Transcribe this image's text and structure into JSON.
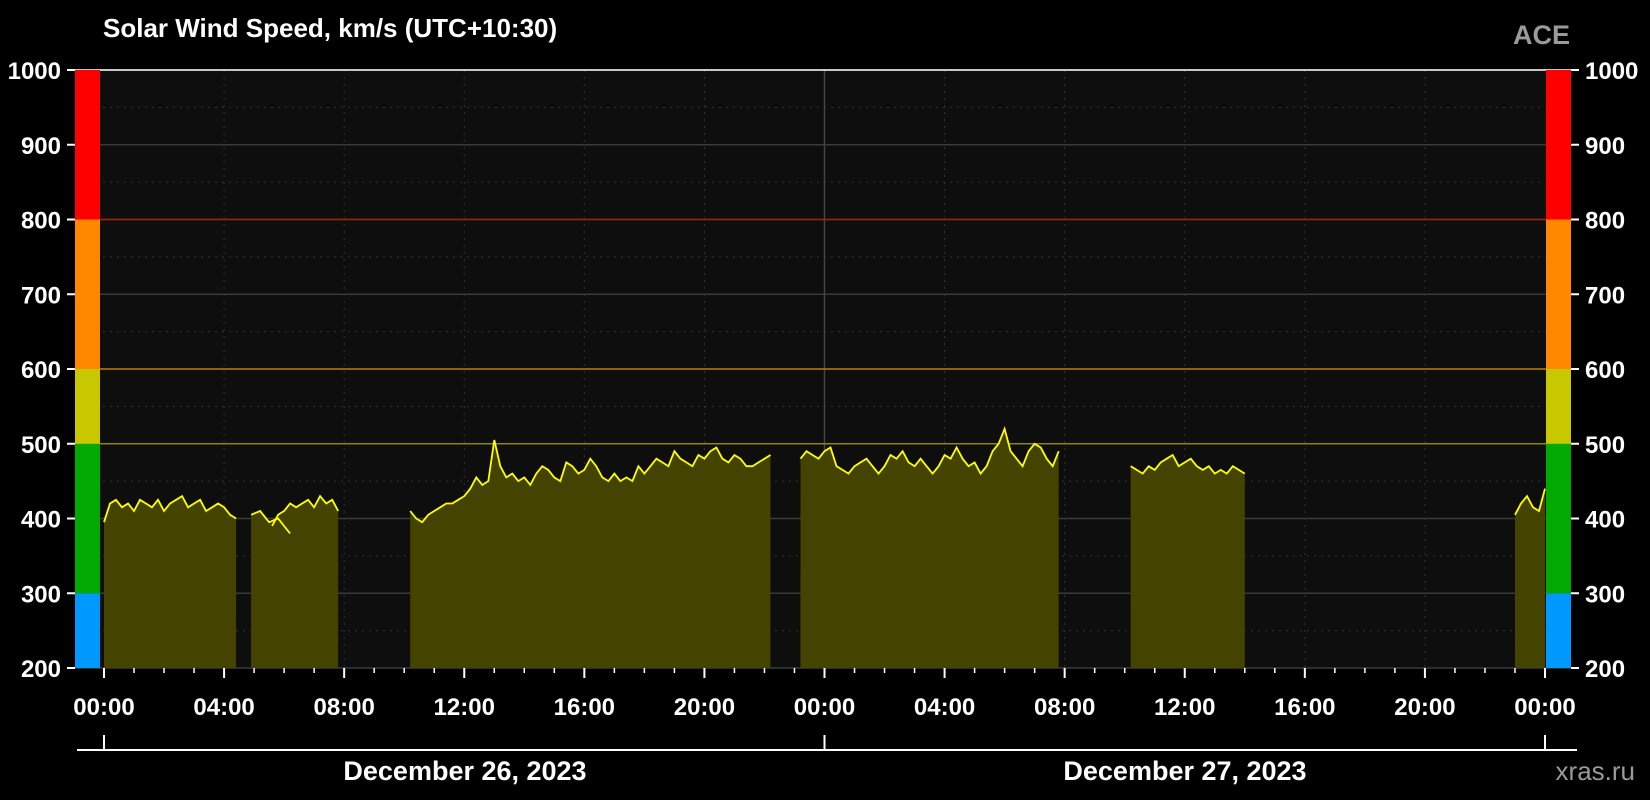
{
  "chart_data": {
    "type": "area",
    "title": "Solar Wind Speed, km/s (UTC+10:30)",
    "source": "ACE",
    "credit": "xras.ru",
    "ylim": [
      200,
      1000
    ],
    "yticks": [
      "1000",
      "900",
      "800",
      "700",
      "600",
      "500",
      "400",
      "300",
      "200"
    ],
    "xlim": [
      0,
      48
    ],
    "xtick_labels": [
      "00:00",
      "04:00",
      "08:00",
      "12:00",
      "16:00",
      "20:00",
      "00:00",
      "04:00",
      "08:00",
      "12:00",
      "16:00",
      "20:00",
      "00:00"
    ],
    "dates": [
      "December 26, 2023",
      "December 27, 2023"
    ],
    "thresholds": [
      {
        "value": 500,
        "color": "#8a8a00"
      },
      {
        "value": 600,
        "color": "#b07800"
      },
      {
        "value": 800,
        "color": "#a02000"
      }
    ],
    "color_scale": [
      {
        "from": 200,
        "to": 300,
        "color": "#0099ff"
      },
      {
        "from": 300,
        "to": 500,
        "color": "#00aa00"
      },
      {
        "from": 500,
        "to": 600,
        "color": "#c8c800"
      },
      {
        "from": 600,
        "to": 800,
        "color": "#ff8800"
      },
      {
        "from": 800,
        "to": 1000,
        "color": "#ff0000"
      }
    ],
    "line_color": "#ffff00",
    "fill_color": "#444400",
    "series": [
      {
        "segments": [
          {
            "x": [
              0.0,
              0.2,
              0.4,
              0.6,
              0.8,
              1.0,
              1.2,
              1.4,
              1.6,
              1.8,
              2.0,
              2.2,
              2.4,
              2.6,
              2.8,
              3.0,
              3.2,
              3.4,
              3.6,
              3.8,
              4.0,
              4.2,
              4.4
            ],
            "y": [
              395,
              420,
              425,
              415,
              420,
              410,
              425,
              420,
              415,
              425,
              410,
              420,
              425,
              430,
              415,
              420,
              425,
              410,
              415,
              420,
              415,
              405,
              400
            ]
          },
          {
            "x": [
              4.9,
              5.2,
              5.5,
              5.8,
              6.0,
              6.2
            ],
            "y": [
              405,
              410,
              395,
              400,
              390,
              380
            ]
          },
          {
            "x": [
              5.6,
              5.8,
              6.0,
              6.2,
              6.4,
              6.6,
              6.8,
              7.0,
              7.2,
              7.4,
              7.6,
              7.8
            ],
            "y": [
              390,
              405,
              410,
              420,
              415,
              420,
              425,
              415,
              430,
              420,
              425,
              410
            ]
          },
          {
            "x": [
              10.2,
              10.4,
              10.6,
              10.8,
              11.0,
              11.2,
              11.4,
              11.6,
              11.8,
              12.0,
              12.2,
              12.4,
              12.6,
              12.8,
              13.0,
              13.2,
              13.4,
              13.6,
              13.8,
              14.0,
              14.2,
              14.4,
              14.6,
              14.8,
              15.0,
              15.2,
              15.4,
              15.6,
              15.8,
              16.0,
              16.2,
              16.4,
              16.6,
              16.8,
              17.0,
              17.2,
              17.4,
              17.6,
              17.8,
              18.0,
              18.2,
              18.4,
              18.6,
              18.8,
              19.0,
              19.2,
              19.4,
              19.6,
              19.8,
              20.0,
              20.2,
              20.4,
              20.6,
              20.8,
              21.0,
              21.2,
              21.4,
              21.6,
              21.8,
              22.0,
              22.2
            ],
            "y": [
              410,
              400,
              395,
              405,
              410,
              415,
              420,
              420,
              425,
              430,
              440,
              455,
              445,
              450,
              505,
              470,
              455,
              460,
              450,
              455,
              445,
              460,
              470,
              465,
              455,
              450,
              475,
              470,
              460,
              465,
              480,
              470,
              455,
              450,
              460,
              450,
              455,
              450,
              470,
              460,
              470,
              480,
              475,
              470,
              490,
              480,
              475,
              470,
              485,
              480,
              490,
              495,
              480,
              475,
              485,
              480,
              470,
              470,
              475,
              480,
              485
            ]
          },
          {
            "x": [
              23.2,
              23.4,
              23.6,
              23.8,
              24.0,
              24.2,
              24.4,
              24.6,
              24.8,
              25.0,
              25.2,
              25.4,
              25.6,
              25.8,
              26.0,
              26.2,
              26.4,
              26.6,
              26.8,
              27.0,
              27.2,
              27.4,
              27.6,
              27.8,
              28.0,
              28.2,
              28.4,
              28.6,
              28.8,
              29.0,
              29.2,
              29.4,
              29.6,
              29.8,
              30.0,
              30.2,
              30.4,
              30.6,
              30.8,
              31.0,
              31.2,
              31.4,
              31.6,
              31.8
            ],
            "y": [
              480,
              490,
              485,
              480,
              490,
              495,
              470,
              465,
              460,
              470,
              475,
              480,
              470,
              460,
              470,
              485,
              480,
              490,
              475,
              470,
              480,
              470,
              460,
              470,
              485,
              480,
              495,
              480,
              470,
              475,
              460,
              470,
              490,
              500,
              520,
              490,
              480,
              470,
              490,
              500,
              495,
              480,
              470,
              490
            ]
          },
          {
            "x": [
              34.2,
              34.4,
              34.6,
              34.8,
              35.0,
              35.2,
              35.4,
              35.6,
              35.8,
              36.0,
              36.2,
              36.4,
              36.6,
              36.8,
              37.0,
              37.2,
              37.4,
              37.6,
              37.8,
              38.0
            ],
            "y": [
              470,
              465,
              460,
              470,
              465,
              475,
              480,
              485,
              470,
              475,
              480,
              470,
              465,
              470,
              460,
              465,
              460,
              470,
              465,
              460
            ]
          },
          {
            "x": [
              47.0,
              47.2,
              47.4,
              47.6,
              47.8,
              48.0
            ],
            "y": [
              405,
              420,
              430,
              415,
              410,
              440
            ]
          }
        ]
      }
    ]
  }
}
